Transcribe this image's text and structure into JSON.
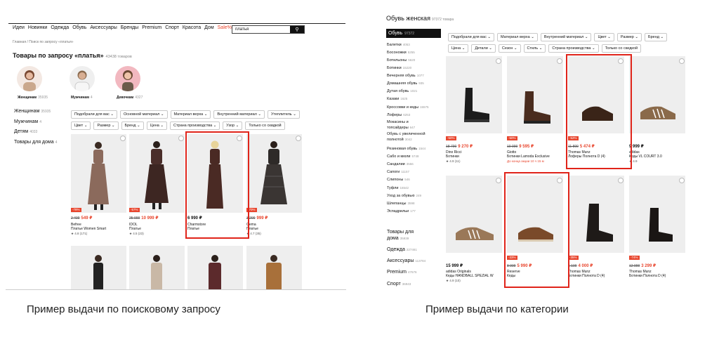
{
  "left": {
    "nav": [
      "Идеи",
      "Новинки",
      "Одежда",
      "Обувь",
      "Аксессуары",
      "Бренды",
      "Premium",
      "Спорт",
      "Красота",
      "Дом",
      "Sale%"
    ],
    "search": {
      "value": "платья",
      "button_icon": "search-icon"
    },
    "breadcrumb": "Главная / Поиск по запросу «платья»",
    "title": "Товары по запросу «платья»",
    "title_count": "43438 товаров",
    "avatars": [
      {
        "label": "Женщинам",
        "count": "35935"
      },
      {
        "label": "Мужчинам",
        "count": "4"
      },
      {
        "label": "Девочкам",
        "count": "4327"
      }
    ],
    "sidebar": [
      {
        "label": "Женщинам",
        "count": "35935"
      },
      {
        "label": "Мужчинам",
        "count": "4"
      },
      {
        "label": "Детям",
        "count": "4033"
      },
      {
        "label": "Товары для дома",
        "count": "4"
      }
    ],
    "filters_row1": [
      "Подобрали для вас",
      "Основной материал",
      "Материал верха",
      "Внутренний материал",
      "Утеплитель"
    ],
    "filters_row2": [
      "Цвет",
      "Размер",
      "Бренд",
      "Цена",
      "Страна производства",
      "Узор",
      "Только со скидкой"
    ],
    "products": [
      {
        "discount": "-78%",
        "old": "2 499",
        "price": "549 ₽",
        "brand": "Befree",
        "name": "Платье Women Smart",
        "rating": "★ 4.8 (171)"
      },
      {
        "discount": "-57%",
        "old": "25 999",
        "price": "10 999 ₽",
        "brand": "IDOL",
        "name": "Платье",
        "rating": "★ 4.5 (23)"
      },
      {
        "discount": "",
        "old": "",
        "price": "6 990 ₽",
        "brand": "Charmstore",
        "name": "Платье",
        "rating": ""
      },
      {
        "discount": "-70%",
        "old": "3 299",
        "price": "999 ₽",
        "brand": "Gema",
        "name": "Платье",
        "rating": "★ 4.7 (35)"
      }
    ]
  },
  "right": {
    "title": "Обувь женская",
    "title_count": "97372 товара",
    "active": {
      "label": "Обувь",
      "count": "97372"
    },
    "categories": [
      {
        "label": "Балетки",
        "count": "4053"
      },
      {
        "label": "Босоножки",
        "count": "5255"
      },
      {
        "label": "Ботильоны",
        "count": "5620"
      },
      {
        "label": "Ботинки",
        "count": "15220"
      },
      {
        "label": "Вечерняя обувь",
        "count": "1077"
      },
      {
        "label": "Домашняя обувь",
        "count": "935"
      },
      {
        "label": "Дутая обувь",
        "count": "1021"
      },
      {
        "label": "Казаки",
        "count": "1625"
      },
      {
        "label": "Кроссовки и кеды",
        "count": "15575"
      },
      {
        "label": "Лоферы",
        "count": "6253"
      },
      {
        "label": "Мокасины и топсайдеры",
        "count": "647"
      },
      {
        "label": "Обувь с увеличенной полнотой",
        "count": "3042"
      },
      {
        "label": "Резиновая обувь",
        "count": "1544"
      },
      {
        "label": "Сабо и мюли",
        "count": "5748"
      },
      {
        "label": "Сандалии",
        "count": "3556"
      },
      {
        "label": "Сапоги",
        "count": "11157"
      },
      {
        "label": "Слипоны",
        "count": "546"
      },
      {
        "label": "Туфли",
        "count": "16542"
      },
      {
        "label": "Уход за обувью",
        "count": "249"
      },
      {
        "label": "Шлепанцы",
        "count": "3598"
      },
      {
        "label": "Эспадрильи",
        "count": "177"
      }
    ],
    "sections": [
      {
        "label": "Товары для дома",
        "count": "35939"
      },
      {
        "label": "Одежда",
        "count": "227461"
      },
      {
        "label": "Аксессуары",
        "count": "113784"
      },
      {
        "label": "Premium",
        "count": "47676"
      },
      {
        "label": "Спорт",
        "count": "36943"
      }
    ],
    "filters_row1": [
      "Подобрали для вас",
      "Материал верха",
      "Внутренний материал",
      "Цвет",
      "Размер",
      "Бренд"
    ],
    "filters_row2": [
      "Цена",
      "Детали",
      "Сезон",
      "Стиль",
      "Страна производства",
      "Только со скидкой"
    ],
    "products": [
      {
        "discount": "-50%",
        "old": "18 790",
        "price": "9 270 ₽",
        "brand": "Dino Ricci",
        "name": "Ботинки",
        "rating": "★ 4.9 (11)",
        "promo": ""
      },
      {
        "discount": "-50%",
        "old": "19 999",
        "price": "9 595 ₽",
        "brand": "Giotto",
        "name": "Ботинки Lamoda Exclusive",
        "rating": "",
        "promo": "До конца акции 10 ч 15 м"
      },
      {
        "discount": "-52%",
        "old": "11 899",
        "price": "5 474 ₽",
        "brand": "Thomas Munz",
        "name": "Лоферы Полнота D (4)",
        "rating": "",
        "promo": ""
      },
      {
        "discount": "",
        "old": "",
        "price": "9 999 ₽",
        "brand": "adidas",
        "name": "Кеды VL COURT 3.0",
        "rating": "★ 4.9",
        "promo": ""
      },
      {
        "discount": "",
        "old": "",
        "price": "15 999 ₽",
        "brand": "adidas Originals",
        "name": "Кеды HANDBALL SPEZIAL W",
        "rating": "★ 4.9 (10)",
        "promo": ""
      },
      {
        "discount": "-33%",
        "old": "8 999",
        "price": "5 990 ₽",
        "brand": "Reserve",
        "name": "Кеды",
        "rating": "",
        "promo": ""
      },
      {
        "discount": "-35%",
        "old": "6 199",
        "price": "4 000 ₽",
        "brand": "Thomas Munz",
        "name": "Ботинки Полнота D (4)",
        "rating": "",
        "promo": ""
      },
      {
        "discount": "-74%",
        "old": "12 999",
        "price": "3 299 ₽",
        "brand": "Thomas Munz",
        "name": "Ботинки Полнота D (4)",
        "rating": "",
        "promo": ""
      }
    ]
  },
  "captions": {
    "left": "Пример выдачи по поисковому запросу",
    "right": "Пример выдачи по категории"
  },
  "colors": {
    "accent": "#e8452d",
    "highlight": "#e0241a"
  }
}
